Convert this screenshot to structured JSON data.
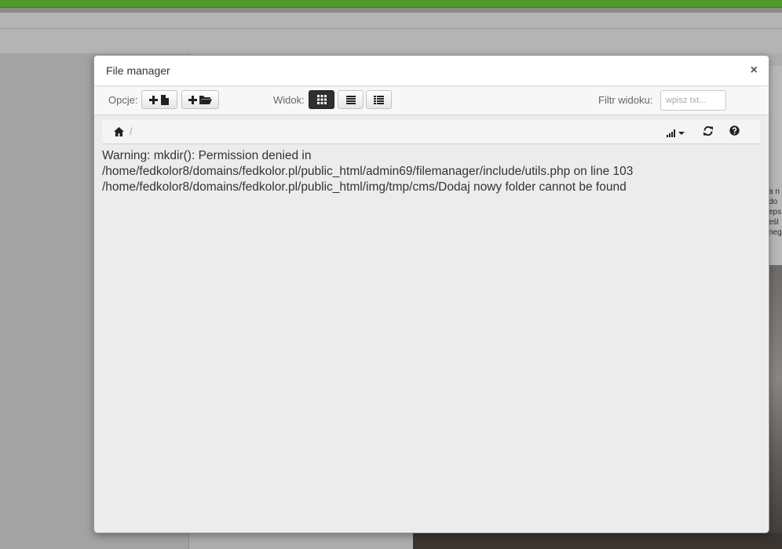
{
  "modal": {
    "title": "File manager",
    "close_label": "×"
  },
  "toolbar": {
    "options_label": "Opcje:",
    "view_label": "Widok:",
    "filter_label": "Filtr widoku:",
    "filter_placeholder": "wpisz txt...",
    "filter_value": ""
  },
  "breadcrumb": {
    "separator": "/"
  },
  "message": {
    "line1": "Warning: mkdir(): Permission denied in",
    "line2": "/home/fedkolor8/domains/fedkolor.pl/public_html/admin69/filemanager/include/utils.php on line 103",
    "line3": "/home/fedkolor8/domains/fedkolor.pl/public_html/img/tmp/cms/Dodaj nowy folder cannot be found"
  },
  "background": {
    "right_text_lines": [
      "a n",
      "do",
      "eps",
      "eśl",
      "neg"
    ]
  },
  "icons": {
    "upload": "plus-file-icon",
    "new_folder": "plus-folder-icon",
    "grid_view": "grid-icon",
    "list_view": "list-icon",
    "columns_view": "columns-list-icon",
    "home": "home-icon",
    "sort": "signal-sort-icon",
    "refresh": "refresh-icon",
    "help": "question-circle-icon"
  },
  "colors": {
    "brand_green": "#4e9a2a",
    "active_button": "#2f2f2f"
  }
}
